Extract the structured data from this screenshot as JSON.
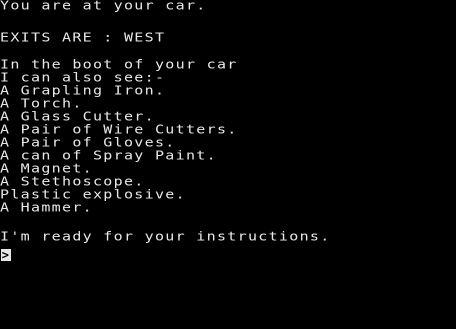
{
  "location": "You are at your car.",
  "exits": "EXITS ARE : WEST",
  "description": {
    "line1": "In the boot of your car",
    "line2": "I can also see:-"
  },
  "items": [
    "A Grapling Iron.",
    "A Torch.",
    "A Glass Cutter.",
    "A Pair of Wire Cutters.",
    "A Pair of Gloves.",
    "A can of Spray Paint.",
    "A Magnet.",
    "A Stethoscope.",
    "Plastic explosive.",
    "A Hammer."
  ],
  "ready_message": "I'm ready for your instructions.",
  "prompt_symbol": ">",
  "colors": {
    "background": "#000000",
    "text": "#e8e8e8"
  }
}
